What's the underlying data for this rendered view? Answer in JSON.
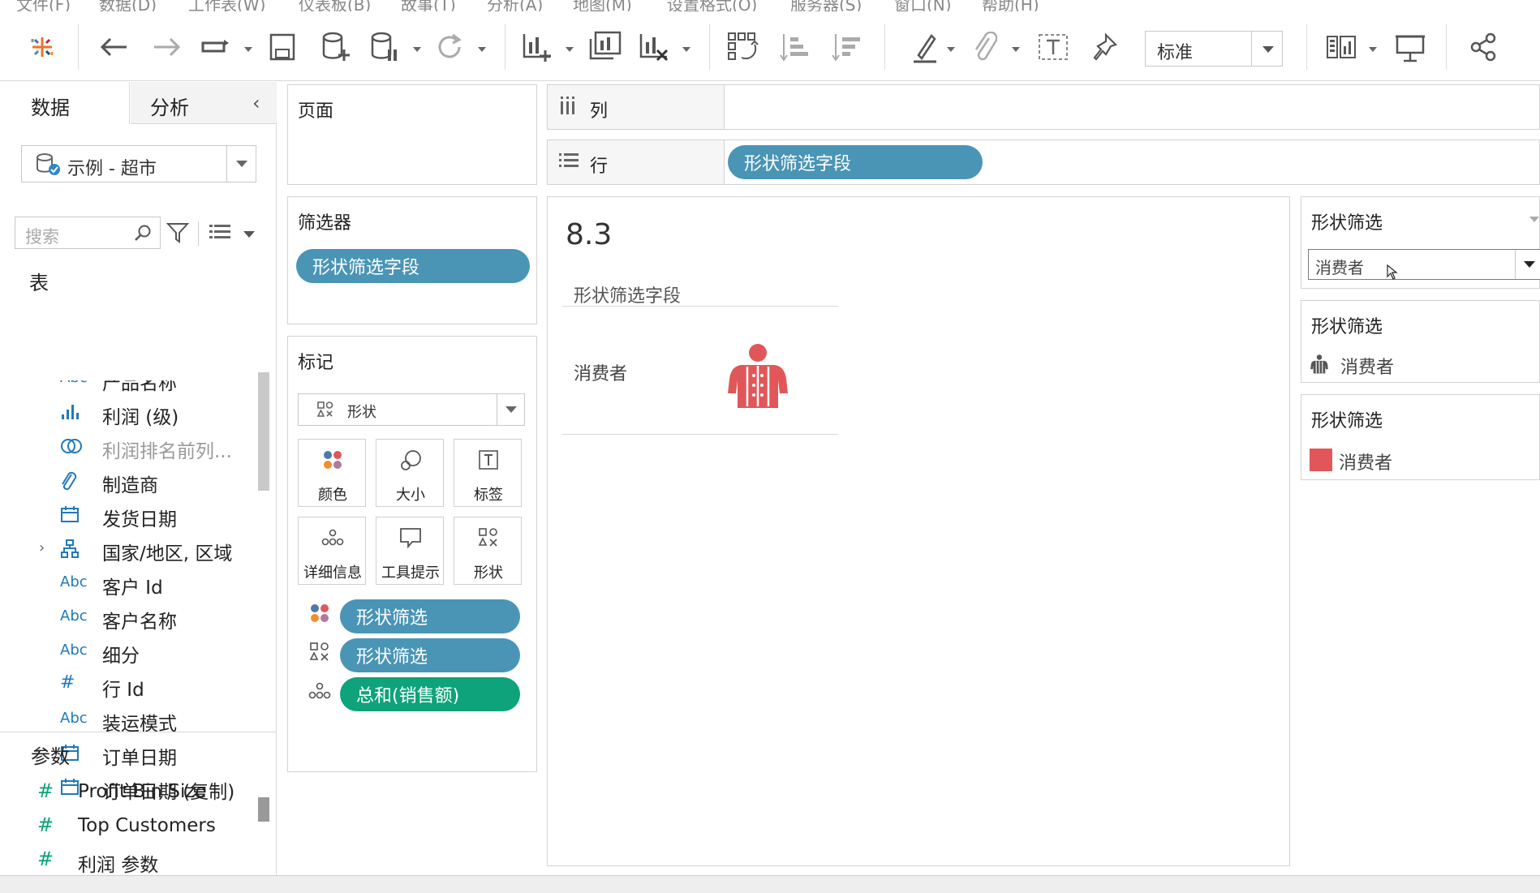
{
  "menubar": {
    "items": [
      "文件(F)",
      "数据(D)",
      "工作表(W)",
      "仪表板(B)",
      "故事(T)",
      "分析(A)",
      "地图(M)",
      "设置格式(O)",
      "服务器(S)",
      "窗口(N)",
      "帮助(H)"
    ]
  },
  "toolbar": {
    "fit_select": "标准",
    "icons": [
      "tableau-logo-icon",
      "undo-icon",
      "redo-icon",
      "replay-icon",
      "save-icon",
      "new-datasource-icon",
      "pause-updates-icon",
      "refresh-icon",
      "new-worksheet-icon",
      "duplicate-sheet-icon",
      "clear-sheet-icon",
      "swap-icon",
      "sort-ascending-icon",
      "sort-descending-icon",
      "highlight-icon",
      "group-icon",
      "show-labels-icon",
      "pin-icon",
      "show-me-icon",
      "presentation-icon",
      "share-icon"
    ]
  },
  "left_panel": {
    "tab_data": "数据",
    "tab_analysis": "分析",
    "datasource": "示例 - 超市",
    "search_placeholder": "搜索",
    "tables_heading": "表",
    "fields": [
      {
        "type": "Abc",
        "label": "产品名称",
        "icon": "string-icon"
      },
      {
        "type": "",
        "label": "利润 (级)",
        "icon": "bin-icon"
      },
      {
        "type": "",
        "label": "利润排名前列...",
        "icon": "set-icon"
      },
      {
        "type": "",
        "label": "制造商",
        "icon": "paperclip-icon"
      },
      {
        "type": "",
        "label": "发货日期",
        "icon": "calendar-icon"
      },
      {
        "type": "",
        "label": "国家/地区, 区域",
        "icon": "hierarchy-icon"
      },
      {
        "type": "Abc",
        "label": "客户 Id",
        "icon": "string-icon"
      },
      {
        "type": "Abc",
        "label": "客户名称",
        "icon": "string-icon"
      },
      {
        "type": "Abc",
        "label": "细分",
        "icon": "string-icon"
      },
      {
        "type": "#",
        "label": "行 Id",
        "icon": "number-icon"
      },
      {
        "type": "Abc",
        "label": "装运模式",
        "icon": "string-icon"
      },
      {
        "type": "",
        "label": "订单日期",
        "icon": "calendar-icon"
      },
      {
        "type": "",
        "label": "订单日期 (复制)",
        "icon": "calendar-icon"
      }
    ],
    "params_heading": "参数",
    "params": [
      {
        "type": "#",
        "label": "Profit Bin Size"
      },
      {
        "type": "#",
        "label": "Top Customers"
      },
      {
        "type": "#",
        "label": "利润 参数"
      }
    ]
  },
  "shelves": {
    "pages_title": "页面",
    "filters_title": "筛选器",
    "filters_pill": "形状筛选字段",
    "marks_title": "标记",
    "mark_type": "形状",
    "mark_cards": [
      "颜色",
      "大小",
      "标签",
      "详细信息",
      "工具提示",
      "形状"
    ],
    "mark_pills": [
      {
        "label": "形状筛选",
        "icon": "color-icon",
        "color": "#4a95b6"
      },
      {
        "label": "形状筛选",
        "icon": "shape-icon",
        "color": "#4a95b6"
      },
      {
        "label": "总和(销售额)",
        "icon": "detail-icon",
        "color": "#0ea37a"
      }
    ],
    "columns_label": "列",
    "rows_label": "行",
    "rows_pill": "形状筛选字段"
  },
  "view": {
    "title": "8.3",
    "header": "形状筛选字段",
    "row_label": "消费者",
    "shape_icon": "consumer-person-icon",
    "shape_color": "#e15759"
  },
  "legends": {
    "filter_card_title": "形状筛选",
    "filter_value": "消费者",
    "shape_card_title": "形状筛选",
    "shape_value": "消费者",
    "color_card_title": "形状筛选",
    "color_value": "消费者",
    "color_swatch": "#e15759"
  }
}
